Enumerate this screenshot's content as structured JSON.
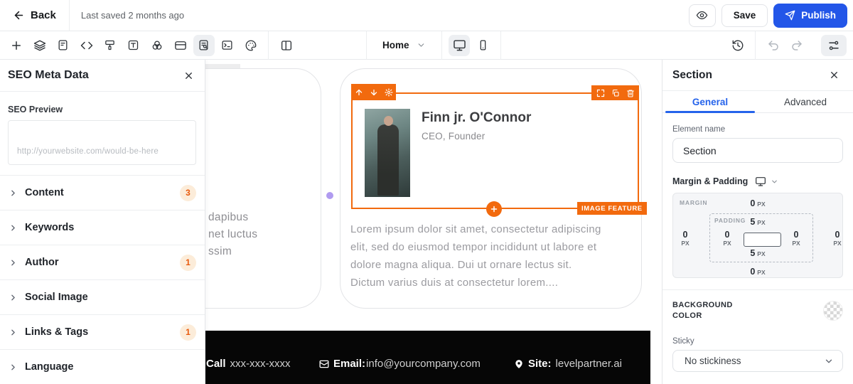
{
  "topbar": {
    "back_label": "Back",
    "last_saved": "Last saved 2 months ago",
    "save_label": "Save",
    "publish_label": "Publish"
  },
  "toolbar": {
    "page_selector_value": "Home"
  },
  "seo_panel": {
    "title": "SEO Meta Data",
    "preview_label": "SEO Preview",
    "preview_placeholder": "http://yourwebsite.com/would-be-here",
    "items": [
      {
        "label": "Content",
        "badge": "3"
      },
      {
        "label": "Keywords",
        "badge": ""
      },
      {
        "label": "Author",
        "badge": "1"
      },
      {
        "label": "Social Image",
        "badge": ""
      },
      {
        "label": "Links & Tags",
        "badge": "1"
      },
      {
        "label": "Language",
        "badge": ""
      }
    ]
  },
  "canvas": {
    "left_card_lines": [
      "dapibus",
      "net luctus",
      "ssim"
    ],
    "profile": {
      "name": "Finn jr. O'Connor",
      "role": "CEO, Founder"
    },
    "feature_tag": "IMAGE FEATURE",
    "body_lines": [
      "Lorem ipsum dolor sit amet, consectetur adipiscing",
      "elit, sed do eiusmod tempor incididunt ut labore et",
      "dolore magna aliqua. Dui ut ornare lectus sit.",
      "Dictum varius duis at consectetur lorem...."
    ],
    "footer": {
      "call_label": "Call",
      "call_value": "xxx-xxx-xxxx",
      "email_label": "Email:",
      "email_value": "info@yourcompany.com",
      "site_label": "Site:",
      "site_value": "levelpartner.ai"
    }
  },
  "inspector": {
    "title": "Section",
    "tabs": {
      "general": "General",
      "advanced": "Advanced"
    },
    "element_name_label": "Element name",
    "element_name_value": "Section",
    "margin_padding_label": "Margin & Padding",
    "box": {
      "margin_tag": "MARGIN",
      "padding_tag": "PADDING",
      "margin_top_v": "0",
      "margin_top_u": "PX",
      "margin_bottom_v": "0",
      "margin_bottom_u": "PX",
      "margin_left_v": "0",
      "margin_left_u": "PX",
      "margin_right_v": "0",
      "margin_right_u": "PX",
      "padding_top_v": "5",
      "padding_top_u": "PX",
      "padding_bottom_v": "5",
      "padding_bottom_u": "PX",
      "padding_left_v": "0",
      "padding_left_u": "PX",
      "padding_right_v": "0",
      "padding_right_u": "PX"
    },
    "background_label": "BACKGROUND COLOR",
    "sticky_label": "Sticky",
    "sticky_value": "No stickiness"
  },
  "icons": [
    "back-arrow",
    "eye",
    "send",
    "plus",
    "layers",
    "file-text",
    "code",
    "paint",
    "text",
    "blend",
    "card",
    "file-search",
    "terminal",
    "palette",
    "panel-left",
    "chevron-down",
    "monitor",
    "smartphone",
    "history",
    "undo",
    "redo",
    "sliders",
    "close-x",
    "chevron-right",
    "arrow-up",
    "arrow-down",
    "gear",
    "maximize",
    "copy",
    "trash",
    "envelope",
    "map-pin",
    "transparency-checker"
  ],
  "colors": {
    "accent_orange": "#F26A0E",
    "primary_blue": "#2356E8",
    "tab_blue": "#2563EB",
    "badge_bg": "#FCECD9",
    "badge_text": "#E8590C",
    "footer_bg": "#060606"
  }
}
